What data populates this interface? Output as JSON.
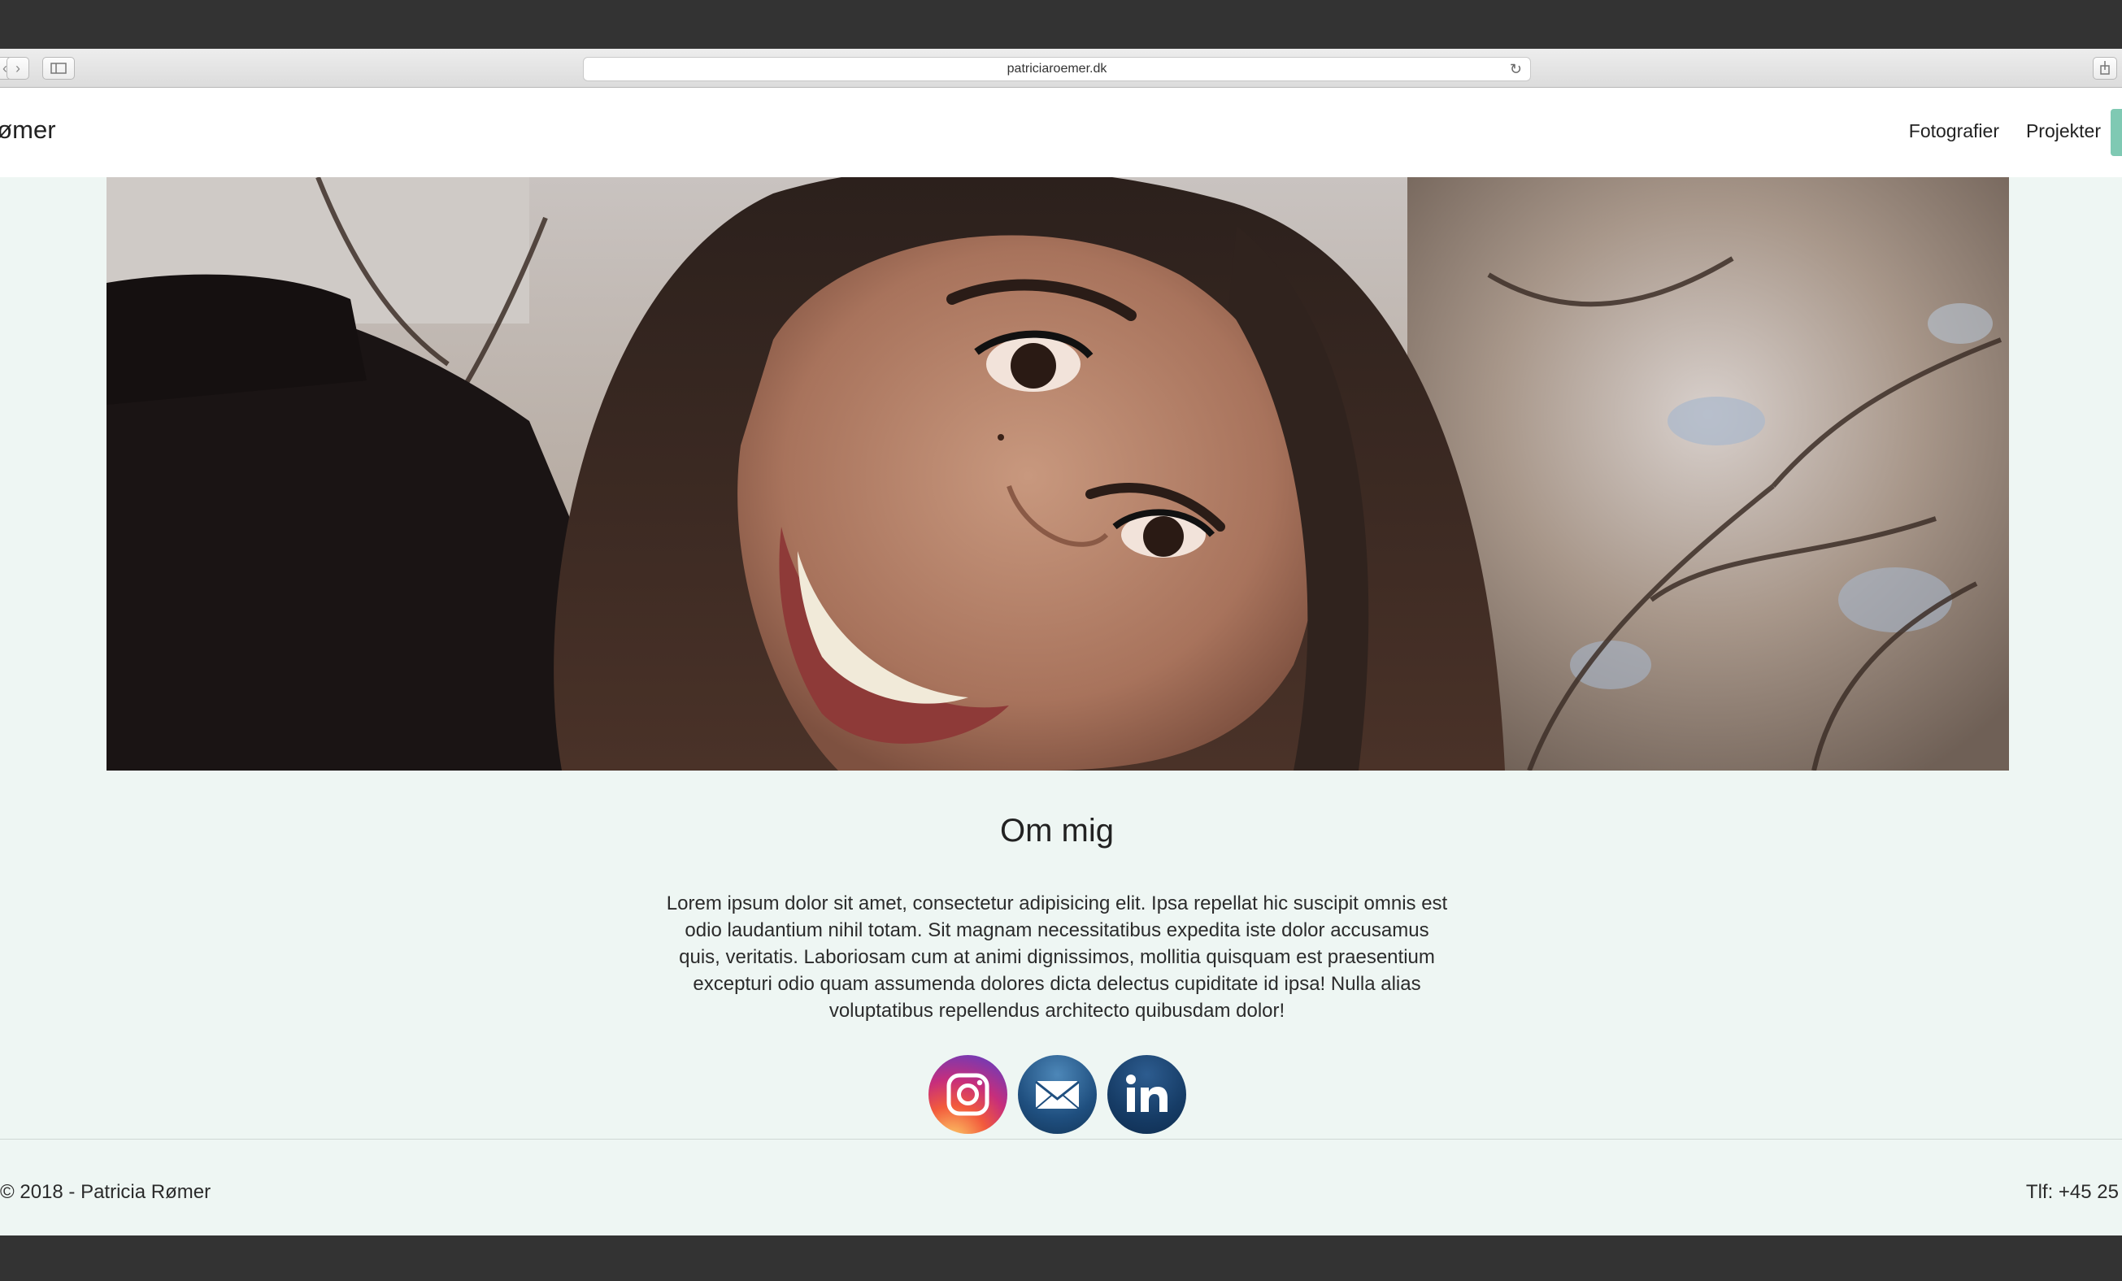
{
  "browser": {
    "url": "patriciaroemer.dk"
  },
  "navbar": {
    "brand": "a Rømer",
    "links": [
      {
        "label": "Fotografier"
      },
      {
        "label": "Projekter"
      }
    ]
  },
  "about": {
    "title": "Om mig",
    "text": "Lorem ipsum dolor sit amet, consectetur adipisicing elit. Ipsa repellat hic suscipit omnis est odio laudantium nihil totam. Sit magnam necessitatibus expedita iste dolor accusamus quis, veritatis. Laboriosam cum at animi dignissimos, mollitia quisquam est praesentium excepturi odio quam assumenda dolores dicta delectus cupiditate id ipsa! Nulla alias voluptatibus repellendus architecto quibusdam dolor!"
  },
  "social": [
    {
      "icon": "instagram-icon"
    },
    {
      "icon": "mail-icon"
    },
    {
      "icon": "linkedin-icon"
    }
  ],
  "footer": {
    "copyright": "© 2018 - Patricia Rømer",
    "phone": "Tlf: +45 25"
  },
  "colors": {
    "page_background": "#eef6f3",
    "nav_accent": "#7fc9b3"
  }
}
